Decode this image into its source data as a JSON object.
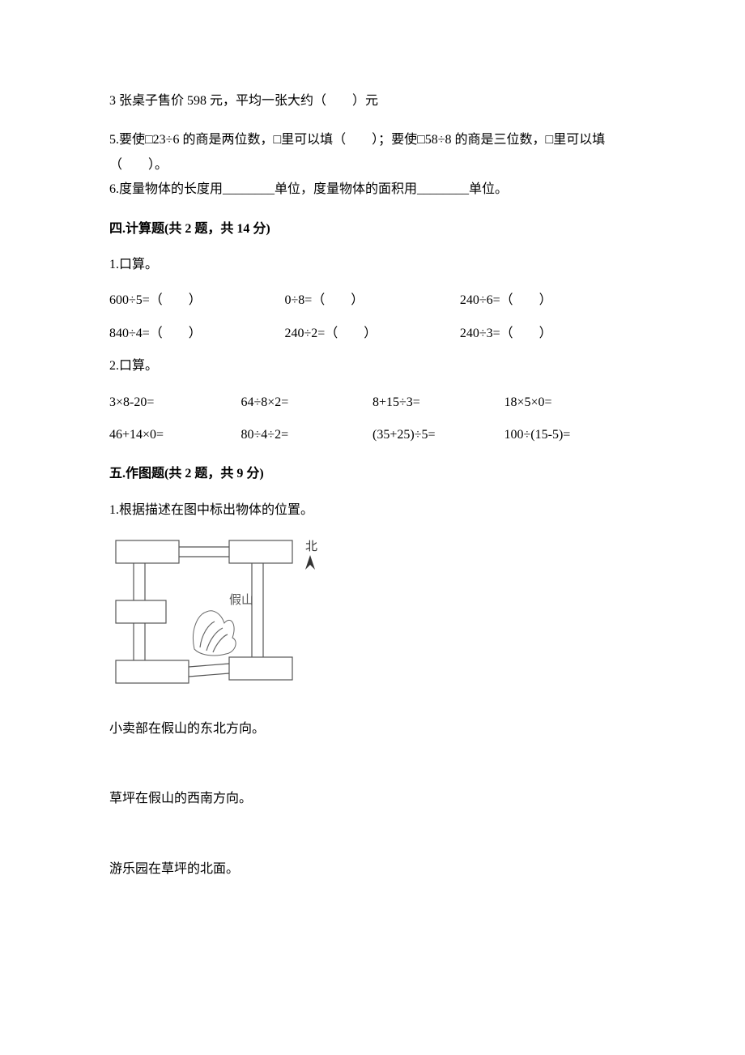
{
  "q_pre": "3 张桌子售价 598 元，平均一张大约（　　）元",
  "q5": "5.要使□23÷6 的商是两位数，□里可以填（　　）；要使□58÷8 的商是三位数，□里可以填（　　）。",
  "q6": "6.度量物体的长度用________单位，度量物体的面积用________单位。",
  "sec4_heading": "四.计算题(共 2 题，共 14 分)",
  "sec4_q1_label": "1.口算。",
  "sec4_q1_rows": [
    [
      "600÷5=（　　）",
      "0÷8=（　　）",
      "240÷6=（　　）"
    ],
    [
      "840÷4=（　　）",
      "240÷2=（　　）",
      "240÷3=（　　）"
    ]
  ],
  "sec4_q2_label": "2.口算。",
  "sec4_q2_rows": [
    [
      "3×8-20=",
      "64÷8×2=",
      "8+15÷3=",
      "18×5×0="
    ],
    [
      "46+14×0=",
      "80÷4÷2=",
      "(35+25)÷5=",
      "100÷(15-5)="
    ]
  ],
  "sec5_heading": "五.作图题(共 2 题，共 9 分)",
  "sec5_q1_label": "1.根据描述在图中标出物体的位置。",
  "figure": {
    "north_label": "北",
    "center_label": "假山"
  },
  "sec5_statements": [
    "小卖部在假山的东北方向。",
    "草坪在假山的西南方向。",
    "游乐园在草坪的北面。"
  ]
}
